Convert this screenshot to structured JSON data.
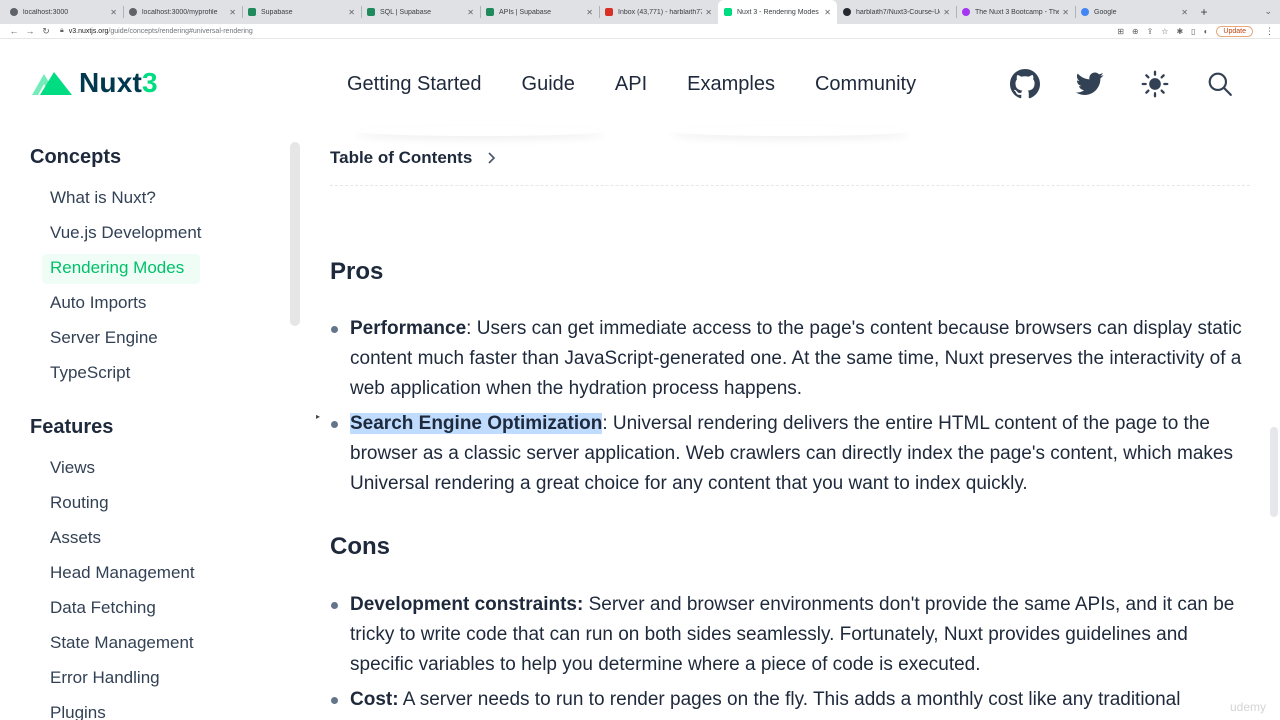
{
  "browser": {
    "tabs": [
      {
        "label": "localhost:3000",
        "color": "#5f6368"
      },
      {
        "label": "localhost:3000/myprofile",
        "color": "#5f6368"
      },
      {
        "label": "Supabase",
        "color": "#1f8a5b"
      },
      {
        "label": "SQL | Supabase",
        "color": "#1f8a5b"
      },
      {
        "label": "APIs | Supabase",
        "color": "#1f8a5b"
      },
      {
        "label": "Inbox (43,771) - harblaith77@",
        "color": "#d93025"
      },
      {
        "label": "Nuxt 3 - Rendering Modes",
        "color": "#00dc82"
      },
      {
        "label": "harblaith7/Nuxt3-Course-Udem",
        "color": "#24292f"
      },
      {
        "label": "The Nuxt 3 Bootcamp - The Co",
        "color": "#a435f0"
      },
      {
        "label": "Google",
        "color": "#4285f4"
      }
    ],
    "active_tab": "Nuxt 3 - Rendering Modes",
    "new_tab": "+",
    "url_host": "v3.nuxtjs.org",
    "url_path": "/guide/concepts/rendering#universal-rendering",
    "update_label": "Update"
  },
  "header": {
    "logo_text": "Nuxt",
    "logo_num": "3",
    "nav": [
      "Getting Started",
      "Guide",
      "API",
      "Examples",
      "Community"
    ],
    "icons": [
      "github-icon",
      "twitter-icon",
      "sun-icon",
      "search-icon"
    ]
  },
  "sidebar": {
    "sections": [
      {
        "title": "Concepts",
        "items": [
          "What is Nuxt?",
          "Vue.js Development",
          "Rendering Modes",
          "Auto Imports",
          "Server Engine",
          "TypeScript"
        ]
      },
      {
        "title": "Features",
        "items": [
          "Views",
          "Routing",
          "Assets",
          "Head Management",
          "Data Fetching",
          "State Management",
          "Error Handling",
          "Plugins"
        ]
      }
    ],
    "active_item": "Rendering Modes"
  },
  "content": {
    "toc_label": "Table of Contents",
    "pros_heading": "Pros",
    "pros": [
      {
        "term": "Performance",
        "sep": ":",
        "text": " Users can get immediate access to the page's content because browsers can display static content much faster than JavaScript-generated one. At the same time, Nuxt preserves the interactivity of a web application when the hydration process happens."
      },
      {
        "term": "Search Engine Optimization",
        "sep": ":",
        "text": " Universal rendering delivers the entire HTML content of the page to the browser as a classic server application. Web crawlers can directly index the page's content, which makes Universal rendering a great choice for any content that you want to index quickly."
      }
    ],
    "cons_heading": "Cons",
    "cons": [
      {
        "term": "Development constraints:",
        "sep": "",
        "text": " Server and browser environments don't provide the same APIs, and it can be tricky to write code that can run on both sides seamlessly. Fortunately, Nuxt provides guidelines and specific variables to help you determine where a piece of code is executed."
      },
      {
        "term": "Cost:",
        "sep": "",
        "text": " A server needs to run to render pages on the fly. This adds a monthly cost like any traditional"
      }
    ]
  },
  "watermark": "udemy",
  "colors": {
    "accent": "#00dc82",
    "brand_dark": "#00384d",
    "highlight": "#bfdbfe"
  }
}
